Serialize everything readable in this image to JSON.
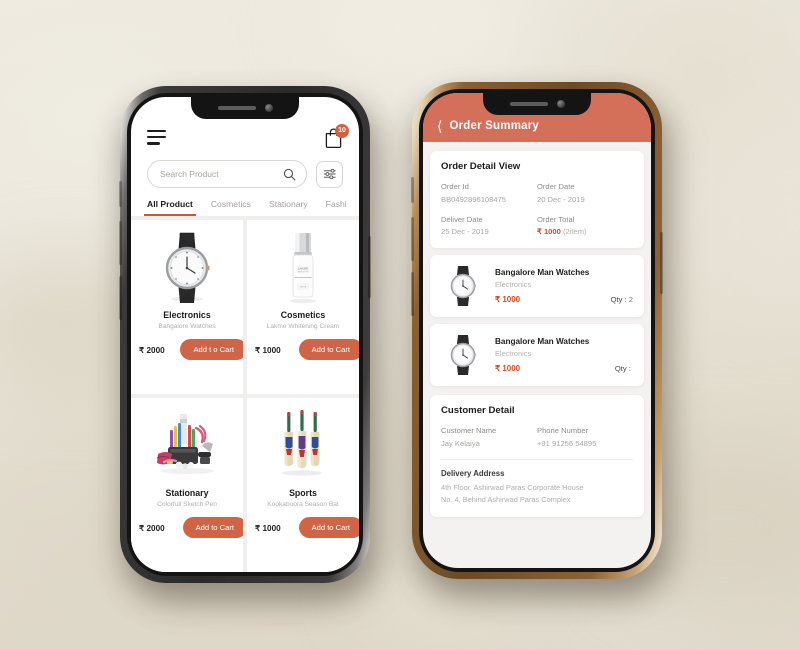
{
  "left_phone": {
    "screen_name": "product-listing",
    "icons": {
      "menu": "hamburger-icon",
      "cart": "shopping-bag-icon",
      "search": "search-icon",
      "filter": "filter-sliders-icon"
    },
    "cart_badge": "10",
    "search": {
      "placeholder": "Search Product",
      "value": ""
    },
    "tabs": [
      {
        "label": "All Product",
        "active": true
      },
      {
        "label": "Cosmetics",
        "active": false
      },
      {
        "label": "Stationary",
        "active": false
      },
      {
        "label": "Fashi",
        "active": false
      }
    ],
    "products": [
      {
        "name": "Electronics",
        "desc": "Bangalore Watches",
        "price": "₹ 2000",
        "button": "Add t o Cart",
        "image": "wrist-watch"
      },
      {
        "name": "Cosmetics",
        "desc": "Lakme Whitening Cream",
        "price": "₹ 1000",
        "button": "Add to Cart",
        "image": "cosmetic-bottle"
      },
      {
        "name": "Stationary",
        "desc": "Colorfull Sketch Pen",
        "price": "₹ 2000",
        "button": "Add to Cart",
        "image": "stationery-set"
      },
      {
        "name": "Sports",
        "desc": "Kookaboora Season Bat",
        "price": "₹ 1000",
        "button": "Add to Cart",
        "image": "cricket-bats"
      }
    ]
  },
  "right_phone": {
    "screen_name": "order-summary",
    "header": {
      "title": "Order Summary",
      "back_icon": "chevron-left-icon"
    },
    "order_detail": {
      "title": "Order Detail View",
      "fields": [
        {
          "label": "Order Id",
          "value": "BB0492896108475"
        },
        {
          "label": "Order Date",
          "value": "20 Dec - 2019"
        },
        {
          "label": "Deliver Date",
          "value": "25 Dec - 2019"
        }
      ],
      "total_label": "Order Total",
      "total_value": "₹ 1000",
      "total_items": "(2item)"
    },
    "items": [
      {
        "name": "Bangalore Man Watches",
        "category": "Electronics",
        "price": "₹ 1000",
        "qty_label": "Qty :",
        "qty": "2"
      },
      {
        "name": "Bangalore Man Watches",
        "category": "Electronics",
        "price": "₹ 1000",
        "qty_label": "Qty :",
        "qty": ""
      }
    ],
    "customer": {
      "title": "Customer Detail",
      "name_label": "Customer Name",
      "name_value": "Jay Kelaiya",
      "phone_label": "Phone Number",
      "phone_value": "+91 91256 54895",
      "address_label": "Delivery Address",
      "address_line1": "4th Floor, Ashirwad Paras Corporate House",
      "address_line2": "No. 4, Behind Ashirwad Paras Complex"
    }
  },
  "colors": {
    "accent_orange": "#cf6546",
    "header_salmon": "#d4705a",
    "price_red": "#d24a22",
    "background": "#e8e3d7"
  }
}
